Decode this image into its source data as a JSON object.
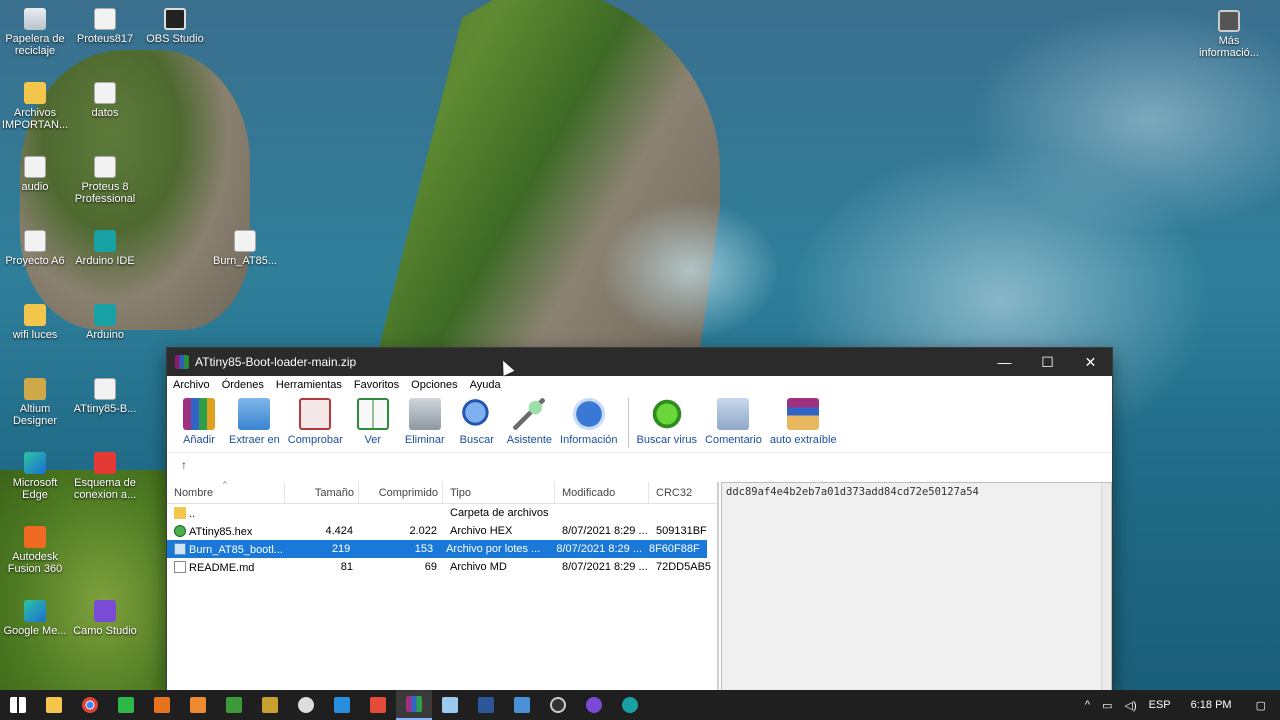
{
  "desktop": {
    "icons": [
      {
        "label": "Papelera de reciclaje",
        "icon": "recycle-bin-icon"
      },
      {
        "label": "Proteus817",
        "icon": "document-icon"
      },
      {
        "label": "OBS Studio",
        "icon": "obs-icon"
      },
      {
        "label": "Archivos IMPORTAN...",
        "icon": "folder-icon"
      },
      {
        "label": "datos",
        "icon": "document-icon"
      },
      {
        "label": "audio",
        "icon": "document-icon"
      },
      {
        "label": "Proteus 8 Professional",
        "icon": "proteus-icon"
      },
      {
        "label": "Proyecto A6",
        "icon": "document-icon"
      },
      {
        "label": "Arduino IDE",
        "icon": "arduino-icon"
      },
      {
        "label": "Burn_AT85...",
        "icon": "batch-file-icon"
      },
      {
        "label": "wifi luces",
        "icon": "folder-icon"
      },
      {
        "label": "Arduino",
        "icon": "arduino-icon"
      },
      {
        "label": "Altium Designer",
        "icon": "altium-icon"
      },
      {
        "label": "ATtiny85-B...",
        "icon": "document-icon"
      },
      {
        "label": "Microsoft Edge",
        "icon": "edge-icon"
      },
      {
        "label": "Esquema de conexion a...",
        "icon": "pdf-icon"
      },
      {
        "label": "Autodesk Fusion 360",
        "icon": "fusion-icon"
      },
      {
        "label": "Google Me...",
        "icon": "edge-icon"
      },
      {
        "label": "Camo Studio",
        "icon": "camo-icon"
      },
      {
        "label": "Más informació...",
        "icon": "info-icon"
      }
    ]
  },
  "window": {
    "title": "ATtiny85-Boot-loader-main.zip",
    "buttons": {
      "minimize": "—",
      "maximize": "☐",
      "close": "✕"
    },
    "menu": [
      "Archivo",
      "Órdenes",
      "Herramientas",
      "Favoritos",
      "Opciones",
      "Ayuda"
    ],
    "toolbar": [
      {
        "label": "Añadir",
        "icon": "add-icon"
      },
      {
        "label": "Extraer en",
        "icon": "extract-icon"
      },
      {
        "label": "Comprobar",
        "icon": "test-icon"
      },
      {
        "label": "Ver",
        "icon": "view-icon"
      },
      {
        "label": "Eliminar",
        "icon": "delete-icon"
      },
      {
        "label": "Buscar",
        "icon": "find-icon"
      },
      {
        "label": "Asistente",
        "icon": "wizard-icon"
      },
      {
        "label": "Información",
        "icon": "info-icon"
      },
      {
        "label": "Buscar virus",
        "icon": "virus-scan-icon"
      },
      {
        "label": "Comentario",
        "icon": "comment-icon"
      },
      {
        "label": "auto extraíble",
        "icon": "sfx-icon"
      }
    ],
    "up_arrow": "↑",
    "columns": {
      "name": "Nombre",
      "size": "Tamaño",
      "compressed": "Comprimido",
      "type": "Tipo",
      "modified": "Modificado",
      "crc": "CRC32"
    },
    "files": [
      {
        "name": "..",
        "size": "",
        "compressed": "",
        "type": "Carpeta de archivos",
        "modified": "",
        "crc": "",
        "icon": "folder-icon"
      },
      {
        "name": "ATtiny85.hex",
        "size": "4.424",
        "compressed": "2.022",
        "type": "Archivo HEX",
        "modified": "8/07/2021 8:29 ...",
        "crc": "509131BF",
        "icon": "hex-file-icon"
      },
      {
        "name": "Burn_AT85_bootl...",
        "size": "219",
        "compressed": "153",
        "type": "Archivo por lotes ...",
        "modified": "8/07/2021 8:29 ...",
        "crc": "8F60F88F",
        "icon": "batch-file-icon"
      },
      {
        "name": "README.md",
        "size": "81",
        "compressed": "69",
        "type": "Archivo MD",
        "modified": "8/07/2021 8:29 ...",
        "crc": "72DD5AB5",
        "icon": "md-file-icon"
      }
    ],
    "comment": "ddc89af4e4b2eb7a01d373add84cd72e50127a54"
  },
  "taskbar": {
    "tray": {
      "language": "ESP",
      "time": "6:18 PM"
    }
  }
}
